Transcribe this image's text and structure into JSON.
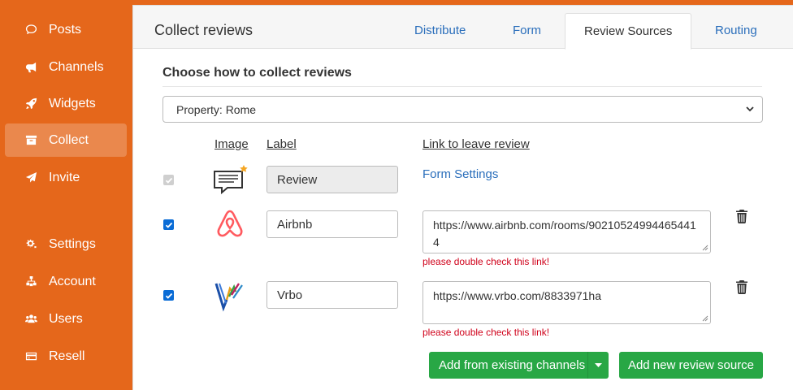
{
  "sidebar": {
    "items": [
      {
        "label": "Posts",
        "icon": "comment-icon"
      },
      {
        "label": "Channels",
        "icon": "megaphone-icon"
      },
      {
        "label": "Widgets",
        "icon": "rocket-icon"
      },
      {
        "label": "Collect",
        "icon": "archive-box-icon",
        "active": true
      },
      {
        "label": "Invite",
        "icon": "paper-plane-icon"
      },
      {
        "label": "Settings",
        "icon": "cogs-icon"
      },
      {
        "label": "Account",
        "icon": "sitemap-icon"
      },
      {
        "label": "Users",
        "icon": "users-icon"
      },
      {
        "label": "Resell",
        "icon": "credit-card-icon"
      }
    ]
  },
  "header": {
    "title": "Collect reviews",
    "tabs": [
      {
        "label": "Distribute"
      },
      {
        "label": "Form"
      },
      {
        "label": "Review Sources",
        "active": true
      },
      {
        "label": "Routing"
      }
    ]
  },
  "section": {
    "title": "Choose how to collect reviews",
    "property_select": "Property: Rome"
  },
  "table": {
    "headers": {
      "image": "Image",
      "label": "Label",
      "link": "Link to leave review"
    },
    "rows": [
      {
        "checked": true,
        "disabled": true,
        "image": "review-star-icon",
        "label": "Review",
        "link_text": "Form Settings"
      },
      {
        "checked": true,
        "image": "airbnb-logo",
        "label": "Airbnb",
        "link": "https://www.airbnb.com/rooms/902105249944654414",
        "warning": "please double check this link!"
      },
      {
        "checked": true,
        "image": "vrbo-logo",
        "label": "Vrbo",
        "link": "https://www.vrbo.com/8833971ha",
        "warning": "please double check this link!"
      }
    ]
  },
  "buttons": {
    "add_existing": "Add from existing channels",
    "add_new": "Add new review source"
  },
  "colors": {
    "sidebar_bg": "#e5671b",
    "primary_button": "#28a745",
    "link": "#2a6ebb",
    "warning": "#d0021b",
    "airbnb": "#ff5a5f"
  }
}
